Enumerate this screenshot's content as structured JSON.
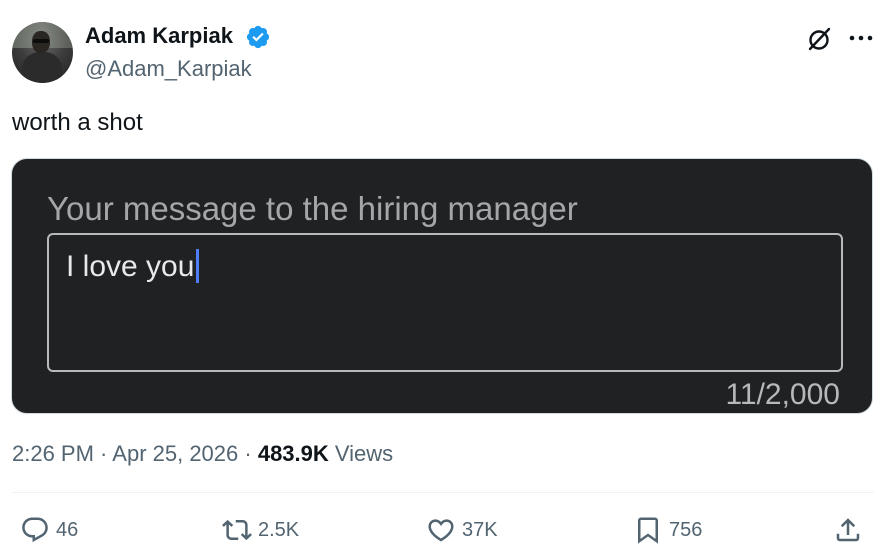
{
  "author": {
    "name": "Adam Karpiak",
    "handle": "@Adam_Karpiak",
    "verified": true
  },
  "tweet": {
    "text": "worth a shot"
  },
  "media": {
    "label": "Your message to the hiring manager",
    "input_text": "I love you",
    "counter": "11/2,000"
  },
  "meta": {
    "time": "2:26 PM",
    "separator": " · ",
    "date": "Apr 25, 2026",
    "views_count": "483.9K",
    "views_label": " Views"
  },
  "actions": {
    "replies": "46",
    "reposts": "2.5K",
    "likes": "37K",
    "bookmarks": "756"
  },
  "colors": {
    "verified_blue": "#1d9bf0",
    "muted_text": "#536471",
    "media_bg": "#202123",
    "caret": "#4f7df5"
  },
  "icons": {
    "verified": "verified-badge-icon",
    "grok": "grok-icon",
    "more": "more-dots-icon",
    "reply": "reply-icon",
    "repost": "repost-icon",
    "like": "heart-icon",
    "bookmark": "bookmark-icon",
    "share": "share-icon"
  }
}
